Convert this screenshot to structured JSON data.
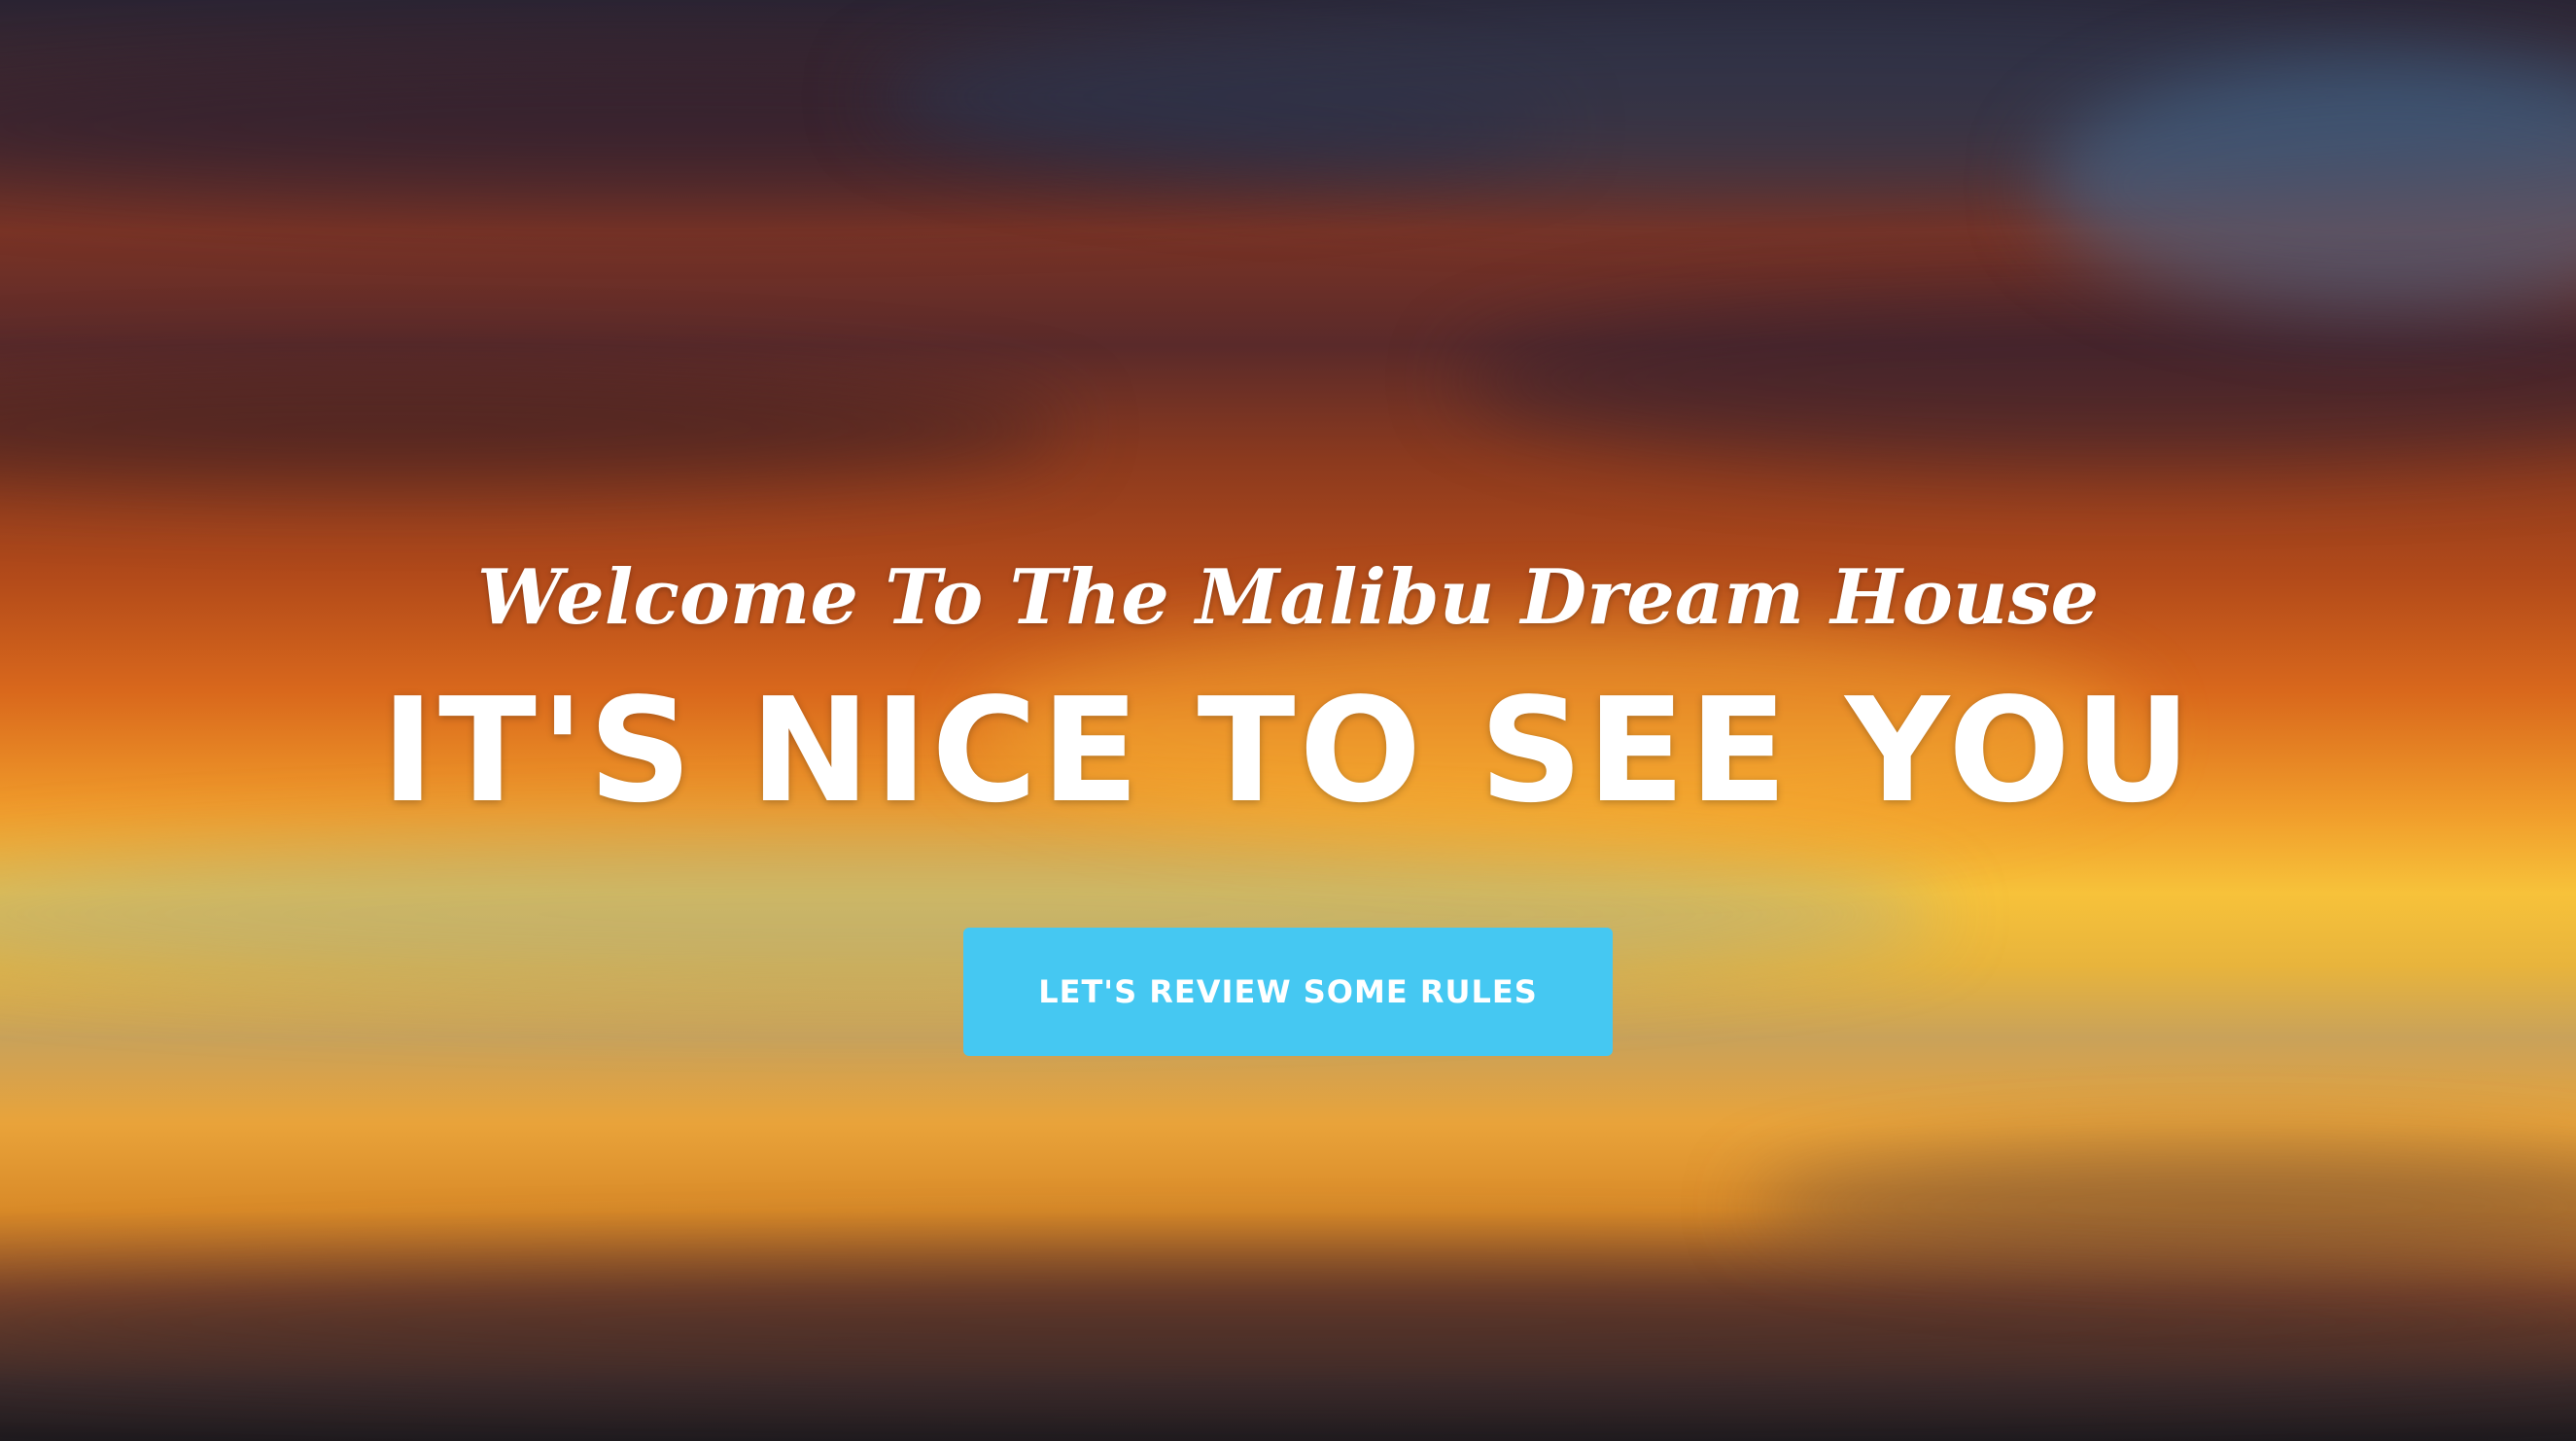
{
  "hero": {
    "subtitle": "Welcome To The Malibu Dream House",
    "headline": "IT'S NICE TO SEE YOU",
    "cta_label": "LET'S REVIEW SOME RULES",
    "colors": {
      "cta_background": "#45c8f2",
      "text": "#ffffff"
    },
    "background": "sunset-sky-photo"
  }
}
